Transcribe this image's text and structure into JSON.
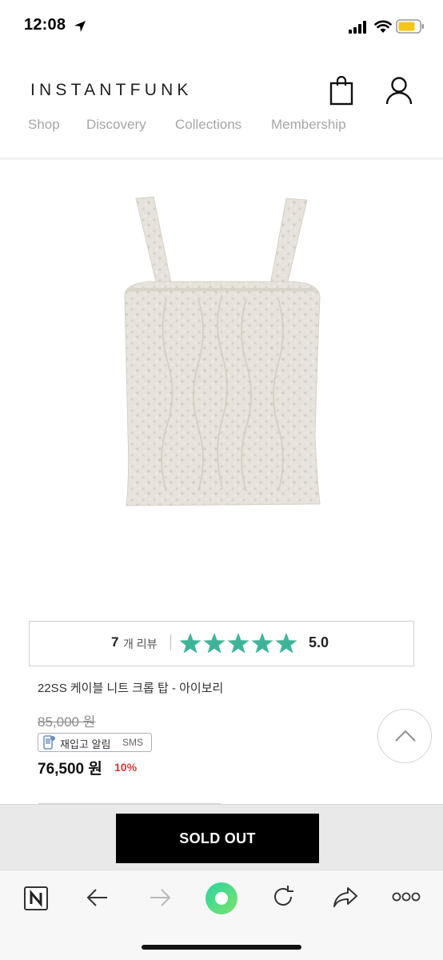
{
  "status_bar": {
    "time": "12:08"
  },
  "header": {
    "brand": "INSTANTFUNK",
    "nav": [
      "Shop",
      "Discovery",
      "Collections",
      "Membership"
    ]
  },
  "product": {
    "image_desc_icon": "knit-crop-top-image",
    "review": {
      "count": "7",
      "count_suffix": "개 리뷰",
      "rating": 5,
      "score": "5.0"
    },
    "name": "22SS 케이블 니트 크롭 탑 - 아이보리",
    "original_price": "85,000 원",
    "restock": {
      "label": "재입고 알림",
      "sms": "SMS"
    },
    "sale_price": "76,500 원",
    "discount": "10%"
  },
  "purchase": {
    "button_label": "SOLD OUT"
  },
  "colors": {
    "star": "#3fb39a",
    "discount": "#d33a3a",
    "nav_text": "#a6a6a6",
    "soldout_bg": "#000000",
    "battery": "#f5c518",
    "browser_center": "#3ddc97"
  }
}
